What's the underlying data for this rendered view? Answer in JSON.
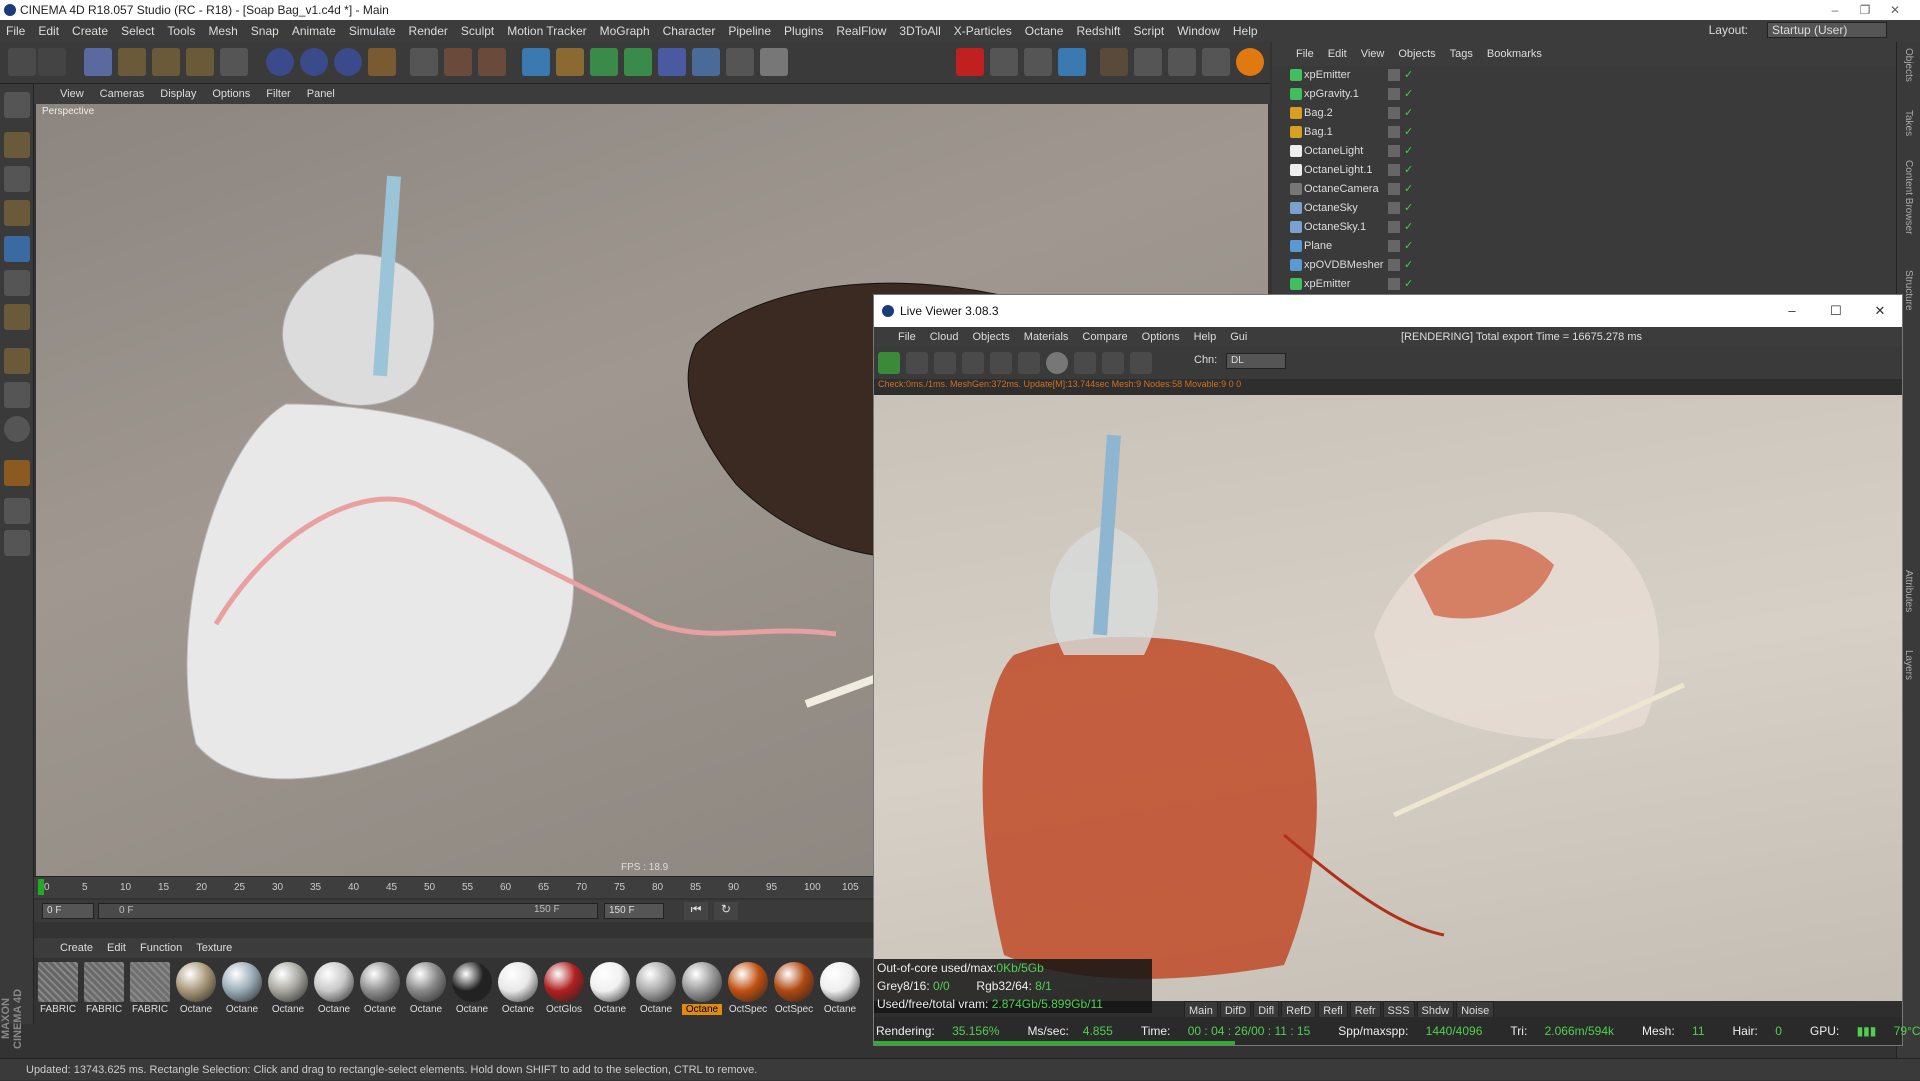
{
  "app": {
    "title": "CINEMA 4D R18.057 Studio (RC - R18) - [Soap Bag_v1.c4d *] - Main",
    "menu": [
      "File",
      "Edit",
      "Create",
      "Select",
      "Tools",
      "Mesh",
      "Snap",
      "Animate",
      "Simulate",
      "Render",
      "Sculpt",
      "Motion Tracker",
      "MoGraph",
      "Character",
      "Pipeline",
      "Plugins",
      "RealFlow",
      "3DToAll",
      "X-Particles",
      "Octane",
      "Redshift",
      "Script",
      "Window",
      "Help"
    ],
    "layout_label": "Layout:",
    "layout_value": "Startup (User)"
  },
  "viewport": {
    "menu": [
      "View",
      "Cameras",
      "Display",
      "Options",
      "Filter",
      "Panel"
    ],
    "camera_label": "Perspective",
    "fps": "FPS : 18.9"
  },
  "timeline": {
    "ticks": [
      "0",
      "5",
      "10",
      "15",
      "20",
      "25",
      "30",
      "35",
      "40",
      "45",
      "50",
      "55",
      "60",
      "65",
      "70",
      "75",
      "80",
      "85",
      "90",
      "95",
      "100",
      "105"
    ],
    "current_frame": "0 F",
    "start_frame": "0 F",
    "end_frame": "150 F",
    "max_frame": "150 F"
  },
  "materials": {
    "menu": [
      "Create",
      "Edit",
      "Function",
      "Texture"
    ],
    "items": [
      {
        "label": "FABRIC",
        "color": "#666"
      },
      {
        "label": "FABRIC",
        "color": "#6a6a6a"
      },
      {
        "label": "FABRIC",
        "color": "#707070"
      },
      {
        "label": "Octane",
        "color": "#a89878"
      },
      {
        "label": "Octane",
        "color": "#9aacb8"
      },
      {
        "label": "Octane",
        "color": "#a8a8a0"
      },
      {
        "label": "Octane",
        "color": "#c8c8c8"
      },
      {
        "label": "Octane",
        "color": "#909090"
      },
      {
        "label": "Octane",
        "color": "#888888"
      },
      {
        "label": "Octane",
        "color": "#222222"
      },
      {
        "label": "Octane",
        "color": "#e8e8e8"
      },
      {
        "label": "OctGlos",
        "color": "#b02020"
      },
      {
        "label": "Octane",
        "color": "#f0f0f0"
      },
      {
        "label": "Octane",
        "color": "#aaaaaa"
      },
      {
        "label": "Octane",
        "color": "#999999"
      },
      {
        "label": "OctSpec",
        "color": "#c05010"
      },
      {
        "label": "OctSpec",
        "color": "#b04810"
      },
      {
        "label": "Octane",
        "color": "#eeeeee"
      }
    ],
    "selected_index": 14
  },
  "status": {
    "text": "Updated: 13743.625 ms.     Rectangle Selection: Click and drag to rectangle-select elements. Hold down SHIFT to add to the selection, CTRL to remove.",
    "brand": "MAXON CINEMA 4D"
  },
  "object_manager": {
    "menu": [
      "File",
      "Edit",
      "View",
      "Objects",
      "Tags",
      "Bookmarks"
    ],
    "objects": [
      {
        "name": "xpEmitter",
        "color": "#3fbf5f"
      },
      {
        "name": "xpGravity.1",
        "color": "#3fbf5f"
      },
      {
        "name": "Bag.2",
        "color": "#d8a020"
      },
      {
        "name": "Bag.1",
        "color": "#d8a020"
      },
      {
        "name": "OctaneLight",
        "color": "#eeeeee"
      },
      {
        "name": "OctaneLight.1",
        "color": "#eeeeee"
      },
      {
        "name": "OctaneCamera",
        "color": "#777777"
      },
      {
        "name": "OctaneSky",
        "color": "#7aa0d0"
      },
      {
        "name": "OctaneSky.1",
        "color": "#7aa0d0"
      },
      {
        "name": "Plane",
        "color": "#5a9ad0"
      },
      {
        "name": "xpOVDBMesher",
        "color": "#5a9ad0"
      },
      {
        "name": "xpEmitter",
        "color": "#3fbf5f"
      }
    ],
    "side_tabs": [
      "Objects",
      "Takes",
      "Content Browser",
      "Structure",
      "Attributes",
      "Layers"
    ]
  },
  "live_viewer": {
    "title": "Live Viewer 3.08.3",
    "menu": [
      "File",
      "Cloud",
      "Objects",
      "Materials",
      "Compare",
      "Options",
      "Help",
      "Gui"
    ],
    "message": "[RENDERING] Total export Time = 16675.278 ms",
    "channel_label": "Chn:",
    "channel_value": "DL",
    "stats": "Check:0ms./1ms. MeshGen:372ms. Update[M]:13.744sec Mesh:9 Nodes:58 Movable:9  0 0",
    "info": {
      "out_of_core_label": "Out-of-core used/max:",
      "out_of_core_value": "0Kb/5Gb",
      "grey_label": "Grey8/16:",
      "grey_value": "0/0",
      "rgb_label": "Rgb32/64:",
      "rgb_value": "8/1",
      "vram_label": "Used/free/total vram:",
      "vram_value": "2.874Gb/5.899Gb/11"
    },
    "tabs": [
      "Main",
      "DifD",
      "Difl",
      "RefD",
      "Refl",
      "Refr",
      "SSS",
      "Shdw",
      "Noise"
    ],
    "bottom": {
      "rendering_label": "Rendering:",
      "rendering_value": "35.156%",
      "mssec_label": "Ms/sec:",
      "mssec_value": "4.855",
      "time_label": "Time:",
      "time_value": "00 : 04 : 26/00 : 11 : 15",
      "spp_label": "Spp/maxspp:",
      "spp_value": "1440/4096",
      "tri_label": "Tri:",
      "tri_value": "2.066m/594k",
      "mesh_label": "Mesh:",
      "mesh_value": "11",
      "hair_label": "Hair:",
      "hair_value": "0",
      "gpu_label": "GPU:",
      "gpu_temp": "79°C"
    },
    "progress": 0.35156
  }
}
